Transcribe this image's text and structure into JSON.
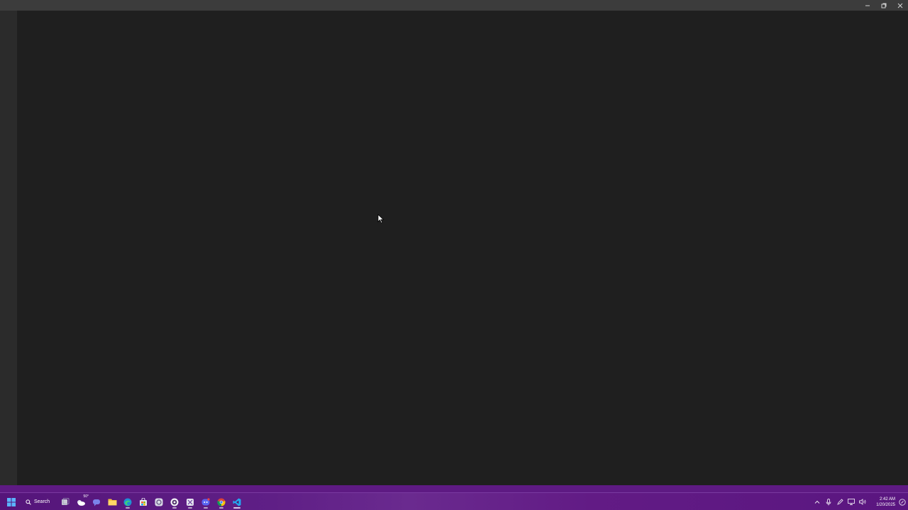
{
  "window": {
    "controls": {
      "minimize_icon": "minimize-icon",
      "restore_icon": "restore-icon",
      "close_icon": "close-icon"
    }
  },
  "taskbar": {
    "search_label": "Search",
    "weather_temp": "50°",
    "apps": [
      {
        "name": "task-view",
        "icon": "task-view-icon"
      },
      {
        "name": "weather",
        "icon": "weather-icon"
      },
      {
        "name": "teams",
        "icon": "chat-icon"
      },
      {
        "name": "file-explorer",
        "icon": "folder-icon"
      },
      {
        "name": "edge",
        "icon": "edge-icon"
      },
      {
        "name": "store",
        "icon": "store-icon"
      },
      {
        "name": "app-8",
        "icon": "app-icon"
      },
      {
        "name": "github-desktop",
        "icon": "github-icon"
      },
      {
        "name": "snipping-tool",
        "icon": "snip-icon"
      },
      {
        "name": "discord",
        "icon": "discord-icon"
      },
      {
        "name": "chrome",
        "icon": "chrome-icon"
      },
      {
        "name": "vscode",
        "icon": "vscode-icon"
      }
    ],
    "clock": {
      "time": "2:42 AM",
      "date": "1/20/2025"
    }
  },
  "colors": {
    "editor_bg": "#1f1f1f",
    "titlebar_bg": "#3c3c3c",
    "activitybar_bg": "#2b2b2b",
    "taskbar_accent": "#5e1a83"
  }
}
